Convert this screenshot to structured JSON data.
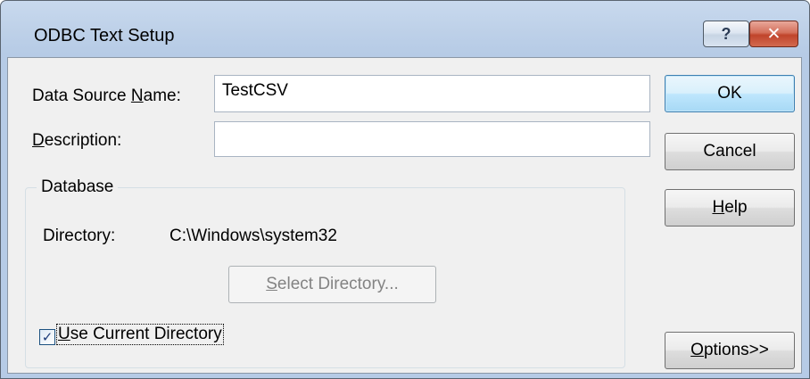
{
  "window": {
    "title": "ODBC Text Setup",
    "help_glyph": "?",
    "close_glyph": "✕"
  },
  "form": {
    "dsn_label_pre": "Data Source ",
    "dsn_label_key": "N",
    "dsn_label_post": "ame:",
    "dsn_value": "TestCSV",
    "desc_label_key": "D",
    "desc_label_post": "escription:",
    "desc_value": ""
  },
  "buttons": {
    "ok": "OK",
    "cancel": "Cancel",
    "help_key": "H",
    "help_rest": "elp",
    "options_key": "O",
    "options_rest": "ptions>>"
  },
  "database": {
    "group_title": "Database",
    "directory_label": "Directory:",
    "directory_value": "C:\\Windows\\system32",
    "select_key": "S",
    "select_rest": "elect Directory...",
    "use_current_key": "U",
    "use_current_rest": "se Current Directory",
    "use_current_checked": true,
    "check_glyph": "✓"
  }
}
